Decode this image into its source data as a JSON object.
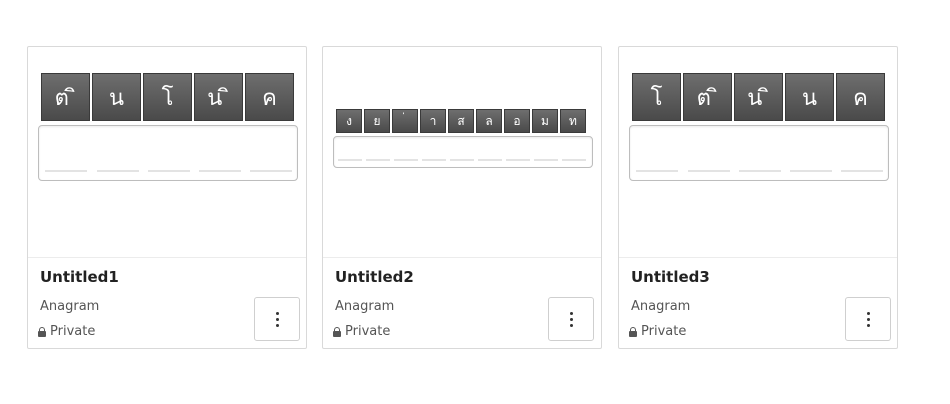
{
  "cards": [
    {
      "title": "Untitled1",
      "type": "Anagram",
      "privacy": "Private",
      "tiles": [
        "ต ิ",
        "น",
        "โ",
        "น ิ",
        "ค"
      ]
    },
    {
      "title": "Untitled2",
      "type": "Anagram",
      "privacy": "Private",
      "tiles": [
        "ง",
        "ย",
        "่",
        "า",
        "ส",
        "ล",
        "อ",
        "ม",
        "ท"
      ]
    },
    {
      "title": "Untitled3",
      "type": "Anagram",
      "privacy": "Private",
      "tiles": [
        "โ",
        "ต ิ",
        "น ิ",
        "น",
        "ค"
      ]
    }
  ],
  "icons": {
    "lock": "lock-icon",
    "menu": "more-vertical-icon"
  }
}
